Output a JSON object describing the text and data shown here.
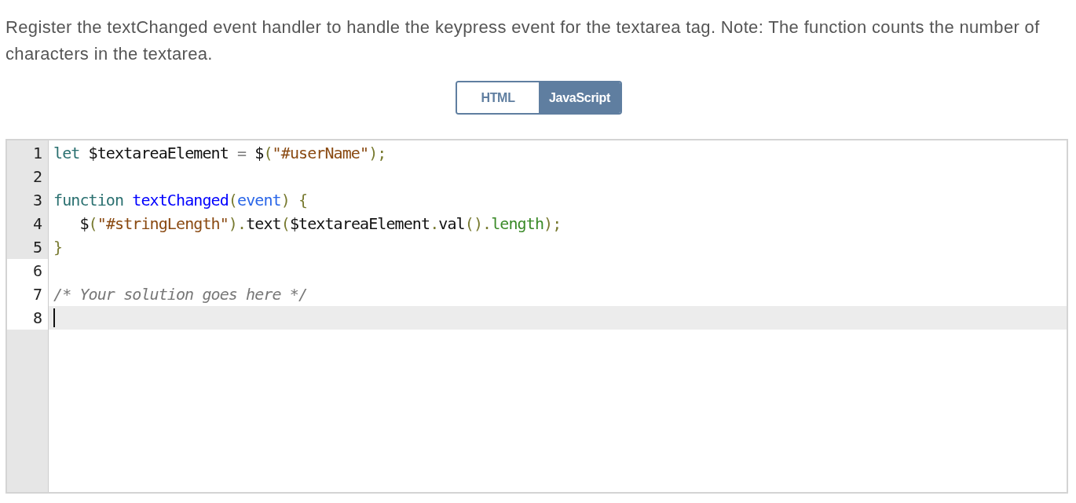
{
  "instructions": "Register the textChanged event handler to handle the keypress event for the textarea tag. Note: The function counts the number of characters in the textarea.",
  "tabs": [
    {
      "label": "HTML",
      "selected": false
    },
    {
      "label": "JavaScript",
      "selected": true
    }
  ],
  "editor": {
    "lines": [
      {
        "number": "1",
        "locked": true,
        "active": false,
        "tokens": [
          {
            "kind": "keyword",
            "text": "let"
          },
          {
            "kind": "plain",
            "text": " $textareaElement "
          },
          {
            "kind": "operator",
            "text": "="
          },
          {
            "kind": "plain",
            "text": " $"
          },
          {
            "kind": "bracket",
            "text": "("
          },
          {
            "kind": "string",
            "text": "\"#userName\""
          },
          {
            "kind": "bracket",
            "text": ")"
          },
          {
            "kind": "bracket",
            "text": ";"
          }
        ]
      },
      {
        "number": "2",
        "locked": true,
        "active": false
      },
      {
        "number": "3",
        "locked": true,
        "active": false,
        "tokens": [
          {
            "kind": "keyword",
            "text": "function "
          },
          {
            "kind": "def",
            "text": "textChanged"
          },
          {
            "kind": "bracket",
            "text": "("
          },
          {
            "kind": "param",
            "text": "event"
          },
          {
            "kind": "bracket",
            "text": ") {"
          }
        ]
      },
      {
        "number": "4",
        "locked": true,
        "active": false,
        "tokens": [
          {
            "kind": "plain",
            "text": "   $"
          },
          {
            "kind": "bracket",
            "text": "("
          },
          {
            "kind": "string",
            "text": "\"#stringLength\""
          },
          {
            "kind": "bracket",
            "text": ")."
          },
          {
            "kind": "plain",
            "text": "text"
          },
          {
            "kind": "bracket",
            "text": "("
          },
          {
            "kind": "plain",
            "text": "$textareaElement"
          },
          {
            "kind": "bracket",
            "text": "."
          },
          {
            "kind": "plain",
            "text": "val"
          },
          {
            "kind": "bracket",
            "text": "()."
          },
          {
            "kind": "property",
            "text": "length"
          },
          {
            "kind": "bracket",
            "text": ");"
          }
        ]
      },
      {
        "number": "5",
        "locked": true,
        "active": false,
        "tokens": [
          {
            "kind": "bracket",
            "text": "}"
          }
        ]
      },
      {
        "number": "6",
        "locked": false,
        "active": false
      },
      {
        "number": "7",
        "locked": false,
        "active": false,
        "tokens": [
          {
            "kind": "comment",
            "text": "/* Your solution goes here */"
          }
        ]
      },
      {
        "number": "8",
        "locked": false,
        "active": true
      }
    ]
  }
}
